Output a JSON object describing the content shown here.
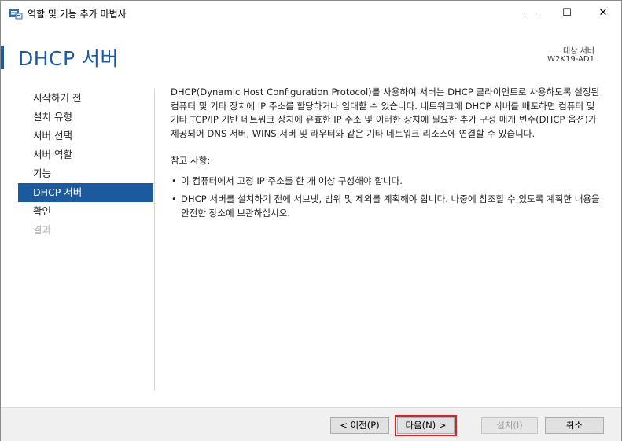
{
  "window": {
    "title": "역할 및 기능 추가 마법사",
    "icon": "server-manager-icon",
    "controls": {
      "minimize": "—",
      "maximize": "☐",
      "close": "✕"
    }
  },
  "header": {
    "page_title": "DHCP 서버",
    "destination_label": "대상 서버",
    "destination_server": "W2K19-AD1",
    "accent_color": "#1c5aa0"
  },
  "nav": {
    "items": [
      {
        "label": "시작하기 전",
        "state": "normal"
      },
      {
        "label": "설치 유형",
        "state": "normal"
      },
      {
        "label": "서버 선택",
        "state": "normal"
      },
      {
        "label": "서버 역할",
        "state": "normal"
      },
      {
        "label": "기능",
        "state": "normal"
      },
      {
        "label": "DHCP 서버",
        "state": "active"
      },
      {
        "label": "확인",
        "state": "normal"
      },
      {
        "label": "결과",
        "state": "disabled"
      }
    ]
  },
  "content": {
    "intro": "DHCP(Dynamic Host Configuration Protocol)를 사용하여 서버는 DHCP 클라이언트로 사용하도록 설정된 컴퓨터 및 기타 장치에 IP 주소를 할당하거나 임대할 수 있습니다. 네트워크에 DHCP 서버를 배포하면 컴퓨터 및 기타 TCP/IP 기반 네트워크 장치에 유효한 IP 주소 및 이러한 장치에 필요한 추가 구성 매개 변수(DHCP 옵션)가 제공되어 DNS 서버, WINS 서버 및 라우터와 같은 기타 네트워크 리소스에 연결할 수 있습니다.",
    "notes_heading": "참고 사항:",
    "bullet_glyph": "•",
    "notes": [
      "이 컴퓨터에서 고정 IP 주소를 한 개 이상 구성해야 합니다.",
      "DHCP 서버를 설치하기 전에 서브넷, 범위 및 제외를 계획해야 합니다. 나중에 참조할 수 있도록 계획한 내용을 안전한 장소에 보관하십시오."
    ]
  },
  "footer": {
    "prev_label": "< 이전(P)",
    "next_label": "다음(N) >",
    "install_label": "설치(I)",
    "cancel_label": "취소",
    "highlight_color": "#e02020"
  }
}
